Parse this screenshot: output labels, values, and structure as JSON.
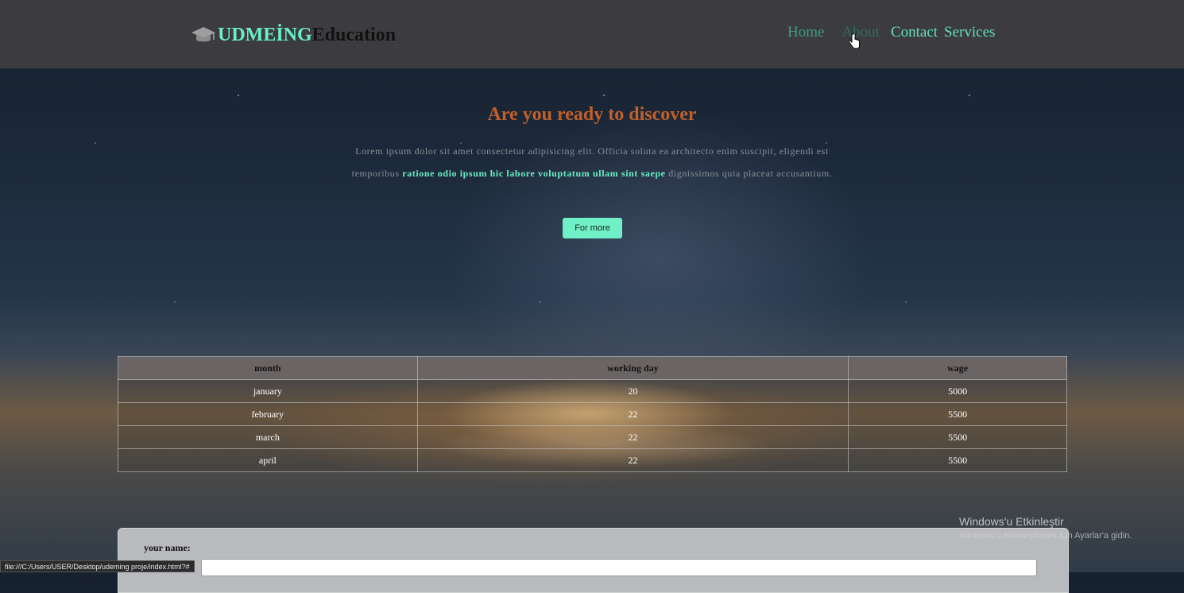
{
  "header": {
    "logo_icon": "graduation-cap-icon",
    "logo_part1": "UDMEİNG",
    "logo_part2": "Education",
    "nav": [
      {
        "label": "Home"
      },
      {
        "label": "About"
      },
      {
        "label": "Contact"
      },
      {
        "label": "Services"
      }
    ]
  },
  "hero": {
    "title": "Are you ready to discover",
    "text_before": "Lorem ipsum dolor sit amet consectetur adipisicing elit. Officia soluta ea architecto enim suscipit, eligendi est temporibus ",
    "text_highlight": "ratione odio ipsum hic labore voluptatum ullam sint saepe",
    "text_after": " dignissimos quia placeat accusantium.",
    "button_label": "For more"
  },
  "table": {
    "headers": [
      "month",
      "working day",
      "wage"
    ],
    "rows": [
      [
        "january",
        "20",
        "5000"
      ],
      [
        "february",
        "22",
        "5500"
      ],
      [
        "march",
        "22",
        "5500"
      ],
      [
        "april",
        "22",
        "5500"
      ]
    ]
  },
  "form": {
    "name_label": "your name:",
    "name_value": ""
  },
  "watermark": {
    "title": "Windows'u Etkinleştir",
    "subtitle": "Windows'u etkinleştirmek için Ayarlar'a gidin."
  },
  "statusbar": {
    "url": "file:///C:/Users/USER/Desktop/udeming proje/index.html?#"
  },
  "colors": {
    "accent": "#69f0c4",
    "title": "#c0602a",
    "header_bg": "#464244"
  }
}
